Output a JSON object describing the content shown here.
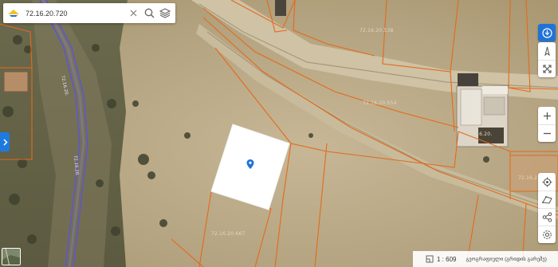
{
  "search": {
    "query": "72.16.20.720"
  },
  "map": {
    "parcels": [
      "72.16.20.538",
      "72.16.20.554",
      "72.16.20.667",
      "72.16.20.",
      "72.16.2"
    ],
    "roads": [
      "72.16.20.",
      "72.16.20."
    ]
  },
  "status": {
    "scale": "1 : 609",
    "projection": "გეოგრაფიული (გრიდის გარეშე)"
  },
  "colors": {
    "accent": "#1f73d8",
    "parcel_border": "#e36a1a",
    "road_border": "#5f58c9",
    "selected_parcel": "#ffffff"
  },
  "icons": [
    "logo-icon",
    "clear-icon",
    "search-icon",
    "layers-icon",
    "expand-panel-icon",
    "info-icon",
    "compass-icon",
    "fullscreen-icon",
    "zoom-in-icon",
    "zoom-out-icon",
    "locate-icon",
    "measure-icon",
    "share-icon",
    "settings-icon",
    "basemap-thumbnail",
    "scale-icon",
    "location-pin-icon"
  ]
}
